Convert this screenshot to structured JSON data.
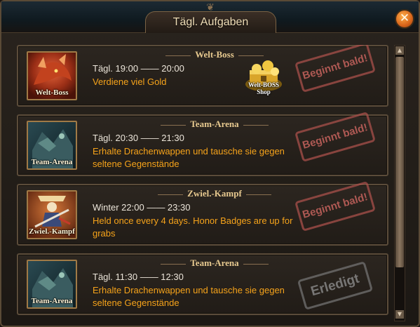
{
  "window": {
    "title": "Tägl. Aufgaben"
  },
  "colors": {
    "accent": "#f6a31a",
    "title": "#e7c98f",
    "stamp": "#be5f5a"
  },
  "tasks": [
    {
      "icon_label": "Welt-Boss",
      "icon": "dragon-icon",
      "title": "Welt-Boss",
      "time": "Tägl. 19:00 —— 20:00",
      "desc": "Verdiene viel Gold",
      "shop_label": "Welt-BOSS Shop",
      "status": "Beginnt bald!"
    },
    {
      "icon_label": "Team-Arena",
      "icon": "arena-icon",
      "title": "Team-Arena",
      "time": "Tägl. 20:30 —— 21:30",
      "desc": "Erhalte Drachenwappen und tausche sie gegen seltene Gegenstände",
      "status": "Beginnt bald!"
    },
    {
      "icon_label": "Zwiel.-Kampf",
      "icon": "duel-icon",
      "title": "Zwiel.-Kampf",
      "time": "Winter 22:00 —— 23:30",
      "desc": "Held once every 4 days. Honor Badges are up for grabs",
      "status": "Beginnt bald!"
    },
    {
      "icon_label": "Team-Arena",
      "icon": "arena-icon",
      "title": "Team-Arena",
      "time": "Tägl. 11:30 —— 12:30",
      "desc": "Erhalte Drachenwappen und tausche sie gegen seltene Gegenstände",
      "status": "Erledigt"
    }
  ]
}
